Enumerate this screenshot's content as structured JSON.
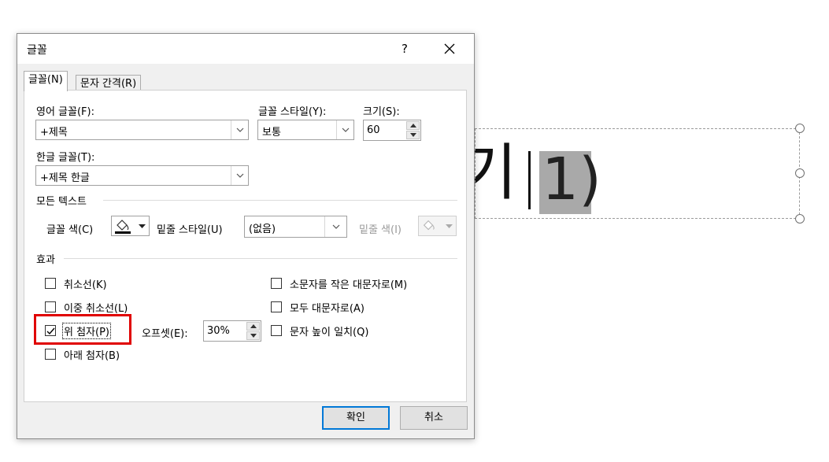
{
  "slide": {
    "text": "기",
    "selected_text": "1)"
  },
  "dialog": {
    "title": "글꼴",
    "help_label": "?",
    "tabs": [
      {
        "label": "글꼴(N)"
      },
      {
        "label": "문자 간격(R)"
      }
    ],
    "english_font": {
      "label": "영어 글꼴(F):",
      "value": "+제목"
    },
    "font_style": {
      "label": "글꼴 스타일(Y):",
      "value": "보통"
    },
    "size": {
      "label": "크기(S):",
      "value": "60"
    },
    "korean_font": {
      "label": "한글 글꼴(T):",
      "value": "+제목 한글"
    },
    "all_text": {
      "section_label": "모든 텍스트",
      "font_color_label": "글꼴 색(C)",
      "underline_style_label": "밑줄 스타일(U)",
      "underline_style_value": "(없음)",
      "underline_color_label": "밑줄 색(I)"
    },
    "effects": {
      "section_label": "효과",
      "strikethrough": {
        "label": "취소선(K)",
        "checked": false
      },
      "double_strikethrough": {
        "label": "이중 취소선(L)",
        "checked": false
      },
      "superscript": {
        "label": "위 첨자(P)",
        "checked": true
      },
      "subscript": {
        "label": "아래 첨자(B)",
        "checked": false
      },
      "offset_label": "오프셋(E):",
      "offset_value": "30%",
      "small_caps": {
        "label": "소문자를 작은 대문자로(M)",
        "checked": false
      },
      "all_caps": {
        "label": "모두 대문자로(A)",
        "checked": false
      },
      "equalize_height": {
        "label": "문자 높이 일치(Q)",
        "checked": false
      }
    },
    "ok_label": "확인",
    "cancel_label": "취소"
  },
  "colors": {
    "accent": "#0078d7",
    "highlight_box": "#e00000",
    "font_color_swatch": "#000000"
  }
}
